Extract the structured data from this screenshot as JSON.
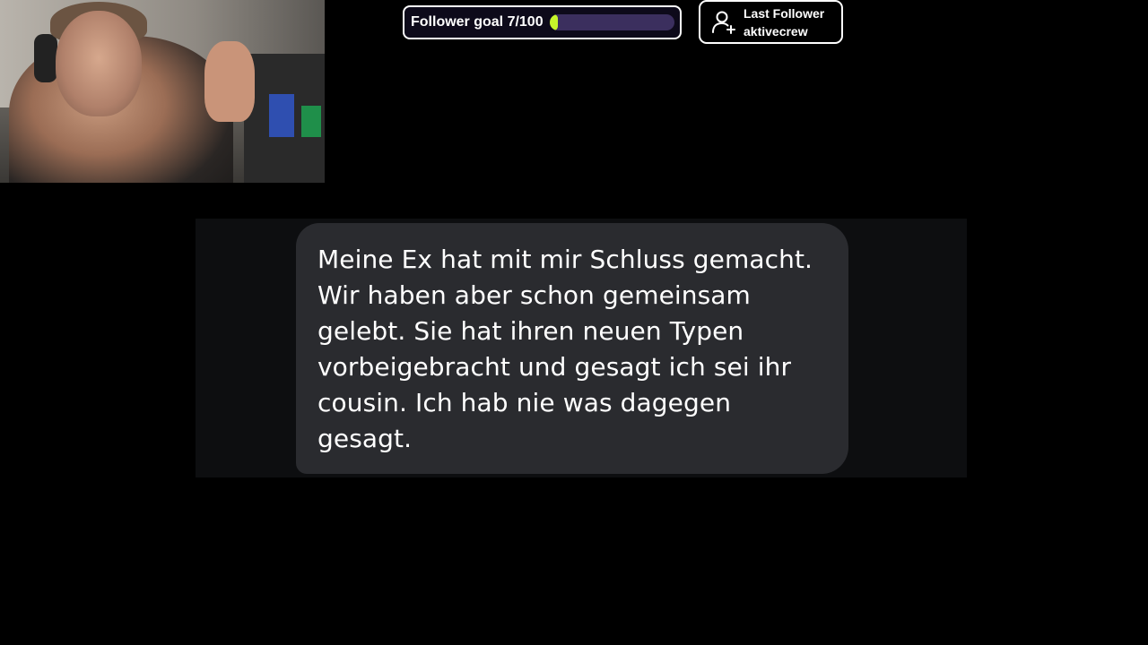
{
  "overlay": {
    "follower_goal": {
      "label": "Follower goal 7/100",
      "current": 7,
      "target": 100,
      "fill_color": "#c6f52a",
      "track_color": "#3b2f5e"
    },
    "last_follower": {
      "icon": "user-plus-icon",
      "title": "Last Follower",
      "name": "aktivecrew"
    }
  },
  "message": {
    "text": "Meine Ex hat mit mir Schluss gemacht. Wir haben aber schon gemeinsam gelebt. Sie hat ihren neuen Typen vorbeigebracht und gesagt ich sei ihr cousin. Ich hab nie was dagegen gesagt.",
    "bubble_color": "#2a2b2f"
  }
}
